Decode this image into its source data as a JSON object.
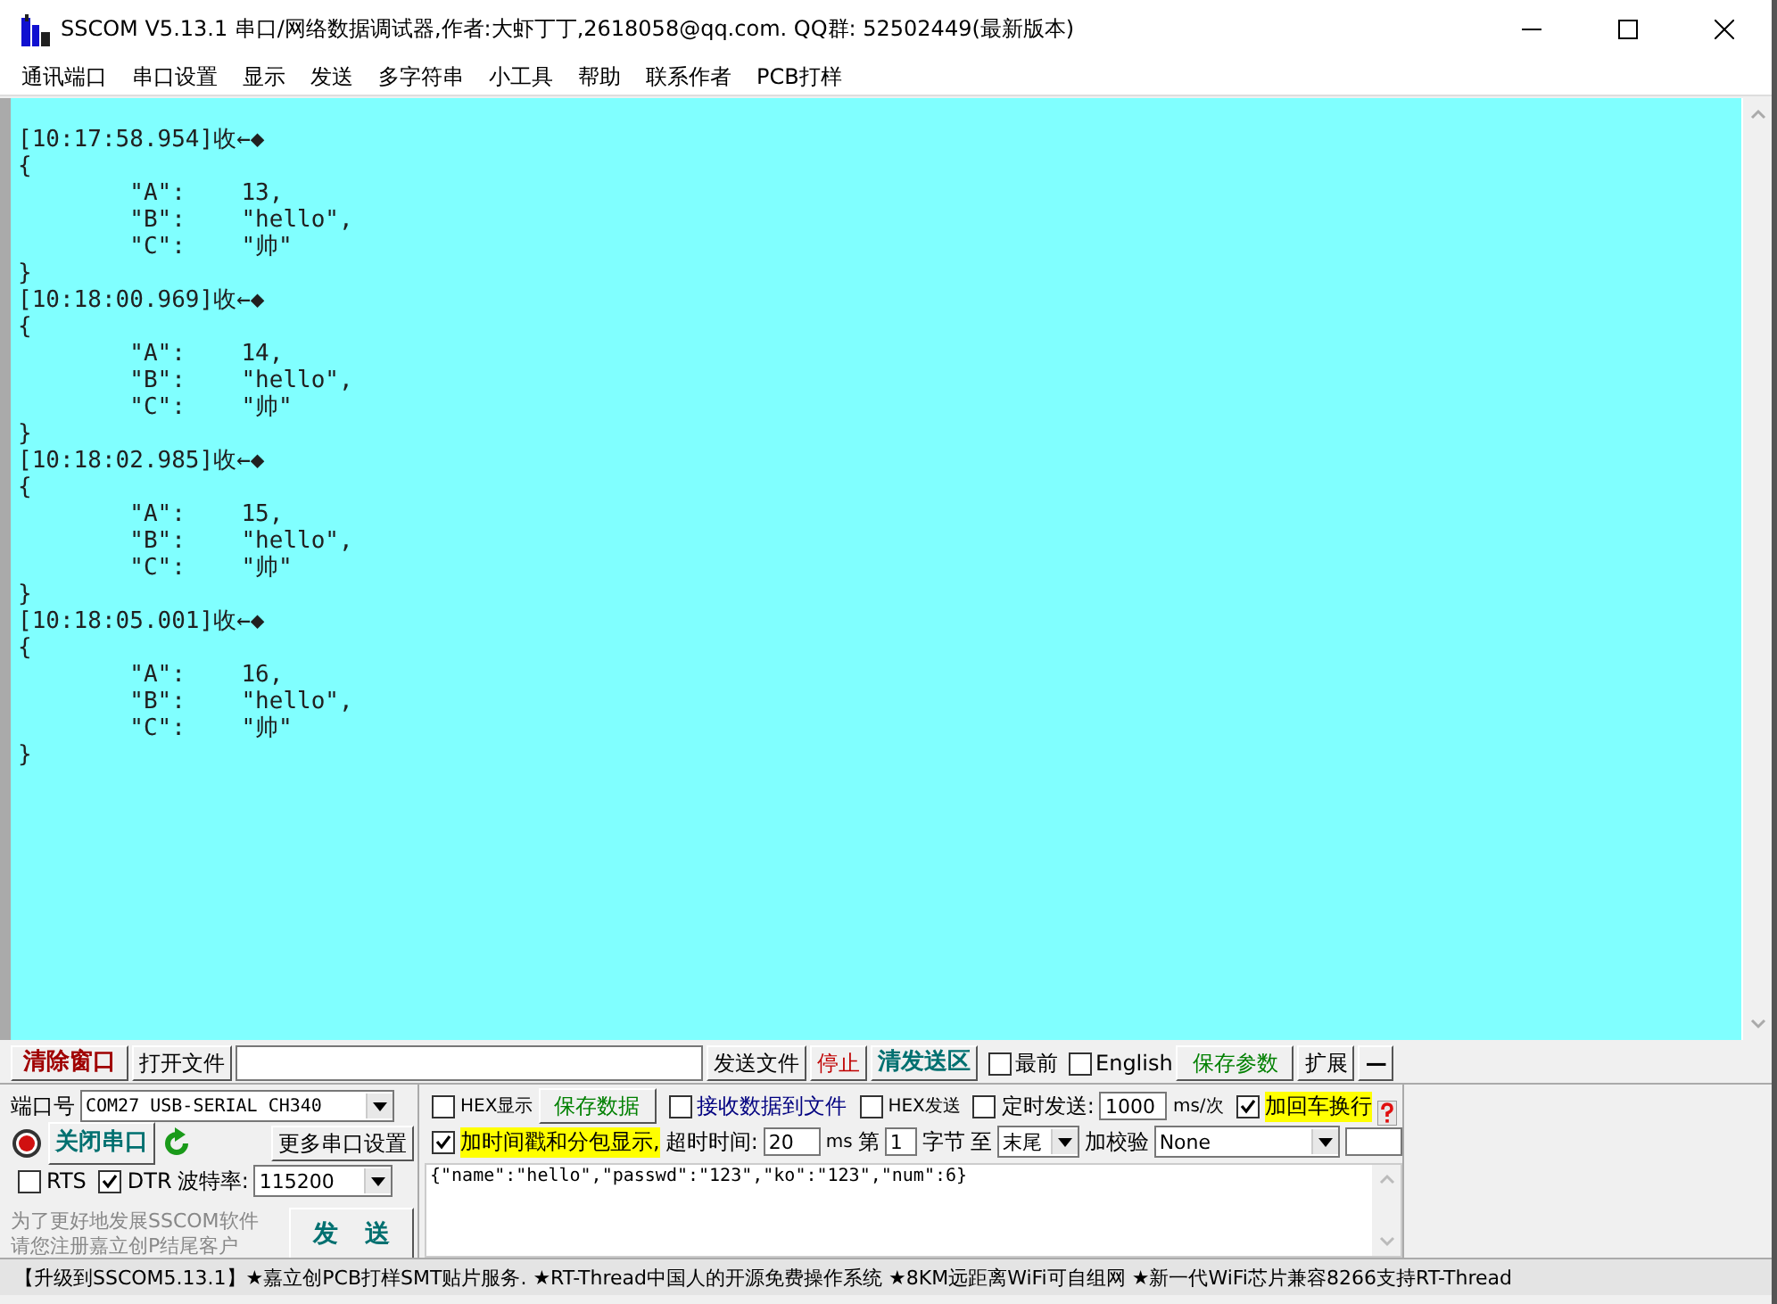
{
  "window": {
    "title": "SSCOM V5.13.1 串口/网络数据调试器,作者:大虾丁丁,2618058@qq.com. QQ群: 52502449(最新版本)"
  },
  "menu": [
    "通讯端口",
    "串口设置",
    "显示",
    "发送",
    "多字符串",
    "小工具",
    "帮助",
    "联系作者",
    "PCB打样"
  ],
  "receive": {
    "lines": [
      "[10:17:58.954]收←◆",
      "{",
      "        \"A\":    13,",
      "        \"B\":    \"hello\",",
      "        \"C\":    \"帅\"",
      "}",
      "[10:18:00.969]收←◆",
      "{",
      "        \"A\":    14,",
      "        \"B\":    \"hello\",",
      "        \"C\":    \"帅\"",
      "}",
      "[10:18:02.985]收←◆",
      "{",
      "        \"A\":    15,",
      "        \"B\":    \"hello\",",
      "        \"C\":    \"帅\"",
      "}",
      "[10:18:05.001]收←◆",
      "{",
      "        \"A\":    16,",
      "        \"B\":    \"hello\",",
      "        \"C\":    \"帅\"",
      "}"
    ]
  },
  "toolbar": {
    "clear_button": "清除窗口",
    "open_file_button": "打开文件",
    "send_file_button": "发送文件",
    "stop_button": "停止",
    "clear_send_button": "清发送区",
    "topmost": {
      "label": "最前",
      "checked": false
    },
    "english": {
      "label": "English",
      "checked": false
    },
    "save_params_button": "保存参数",
    "expand_button": "扩展",
    "collapse_button": "—"
  },
  "port": {
    "label": "端口号",
    "value": "COM27 USB-SERIAL CH340",
    "close_port_button": "关闭串口",
    "more_settings_button": "更多串口设置",
    "rts": {
      "label": "RTS",
      "checked": false
    },
    "dtr": {
      "label": "DTR",
      "checked": true
    },
    "baud_label": "波特率:",
    "baud_value": "115200",
    "promo": [
      "为了更好地发展SSCOM软件",
      "请您注册嘉立创P结尾客户"
    ],
    "send_button": "发 送"
  },
  "options": {
    "hex_display": {
      "label": "HEX显示",
      "checked": false
    },
    "save_data_button": "保存数据",
    "receive_to_file": {
      "label": "接收数据到文件",
      "checked": false
    },
    "hex_send": {
      "label": "HEX发送",
      "checked": false
    },
    "timed_send": {
      "label": "定时发送:",
      "checked": false
    },
    "interval": "1000",
    "interval_unit": "ms/次",
    "append_newline": {
      "label": "加回车换行",
      "checked": true
    },
    "timestamp": {
      "label": "加时间戳和分包显示,",
      "checked": true
    },
    "timeout_label": "超时时间:",
    "timeout": "20",
    "timeout_unit": "ms",
    "from_label": "第",
    "from_byte": "1",
    "byte_label": "字节",
    "to_label": "至",
    "to_value": "末尾",
    "checksum_label": "加校验",
    "checksum": "None"
  },
  "send_text": "{\"name\":\"hello\",\"passwd\":\"123\",\"ko\":\"123\",\"num\":6}",
  "status_bar": "【升级到SSCOM5.13.1】★嘉立创PCB打样SMT贴片服务. ★RT-Thread中国人的开源免费操作系统 ★8KM远距离WiFi可自组网 ★新一代WiFi芯片兼容8266支持RT-Thread"
}
